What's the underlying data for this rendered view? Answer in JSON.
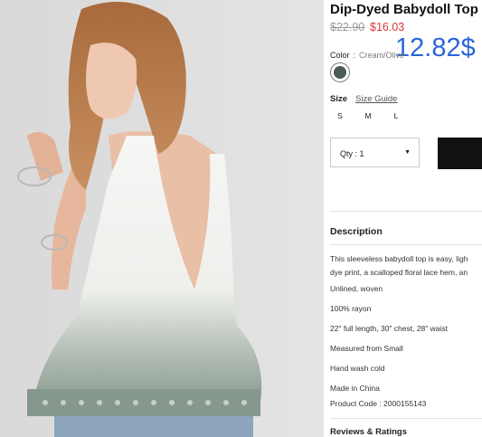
{
  "product": {
    "title": "Dip-Dyed Babydoll Top",
    "original_price": "$22.90",
    "sale_price": "$16.03",
    "overlay_price": "12.82$"
  },
  "color": {
    "label": "Color",
    "separator": ":",
    "value": "Cream/Olive",
    "swatch_color": "#4a5a58"
  },
  "size": {
    "label": "Size",
    "guide_link": "Size Guide",
    "options": [
      "S",
      "M",
      "L"
    ]
  },
  "quantity": {
    "label": "Qty : 1",
    "caret": "▼"
  },
  "description": {
    "title": "Description",
    "text_line1": "This sleeveless babydoll top is easy, ligh",
    "text_line2": "dye print, a scalloped floral lace hem, an",
    "details": [
      "Unlined, woven",
      "100% rayon",
      "22\" full length, 30\" chest, 28\" waist",
      "Measured from Small",
      "Hand wash cold",
      "Made in China",
      "Product Code : 2000155143"
    ]
  },
  "reviews": {
    "title": "Reviews & Ratings"
  },
  "colors": {
    "sale_red": "#d93838",
    "overlay_blue": "#2a66d6",
    "button_black": "#111111"
  }
}
